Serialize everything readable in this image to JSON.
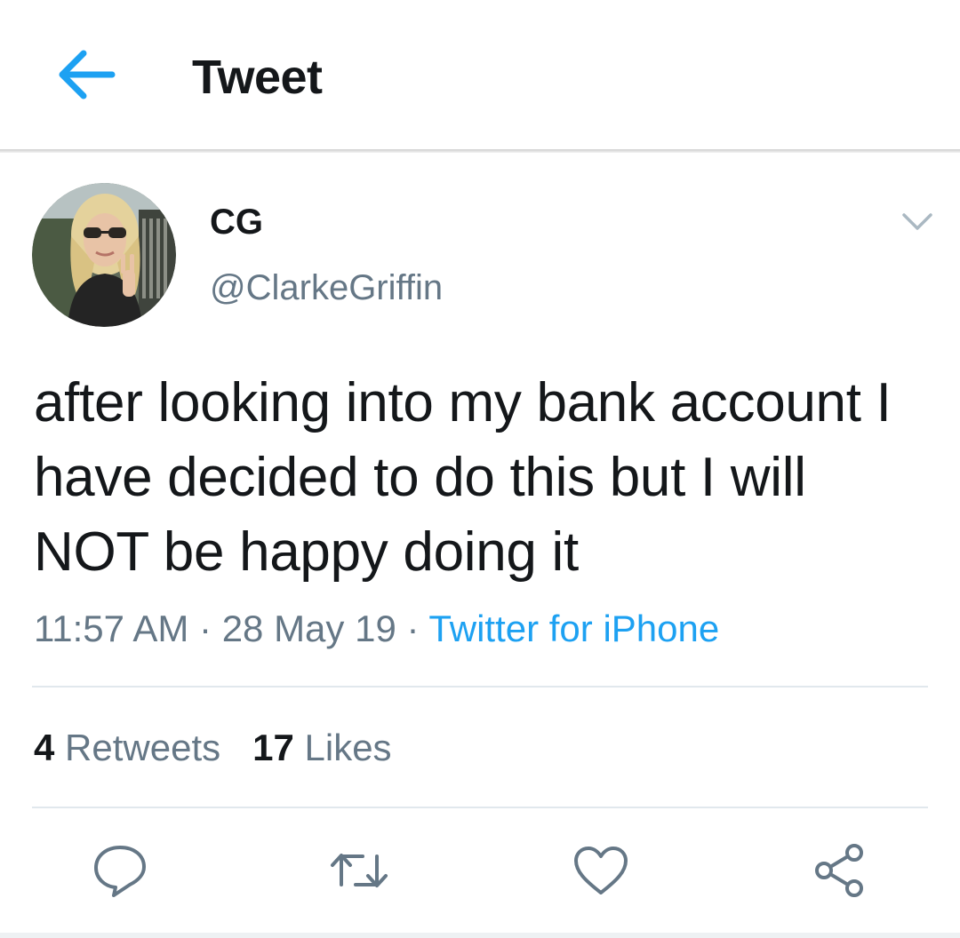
{
  "header": {
    "title": "Tweet",
    "back_icon": "back-arrow-icon"
  },
  "colors": {
    "accent": "#1da1f2",
    "text_primary": "#14171a",
    "text_secondary": "#657786",
    "divider": "#e1e8ed"
  },
  "tweet": {
    "author": {
      "display_name": "CG",
      "handle": "@ClarkeGriffin"
    },
    "text": "after looking into my bank account I have decided to do this but I will NOT be happy doing it",
    "time": "11:57 AM",
    "date": "28 May 19",
    "separator": "·",
    "source": "Twitter for iPhone",
    "stats": {
      "retweets_count": "4",
      "retweets_label": "Retweets",
      "likes_count": "17",
      "likes_label": "Likes"
    },
    "actions": [
      {
        "name": "reply",
        "icon": "reply-icon"
      },
      {
        "name": "retweet",
        "icon": "retweet-icon"
      },
      {
        "name": "like",
        "icon": "heart-icon"
      },
      {
        "name": "share",
        "icon": "share-icon"
      }
    ]
  }
}
